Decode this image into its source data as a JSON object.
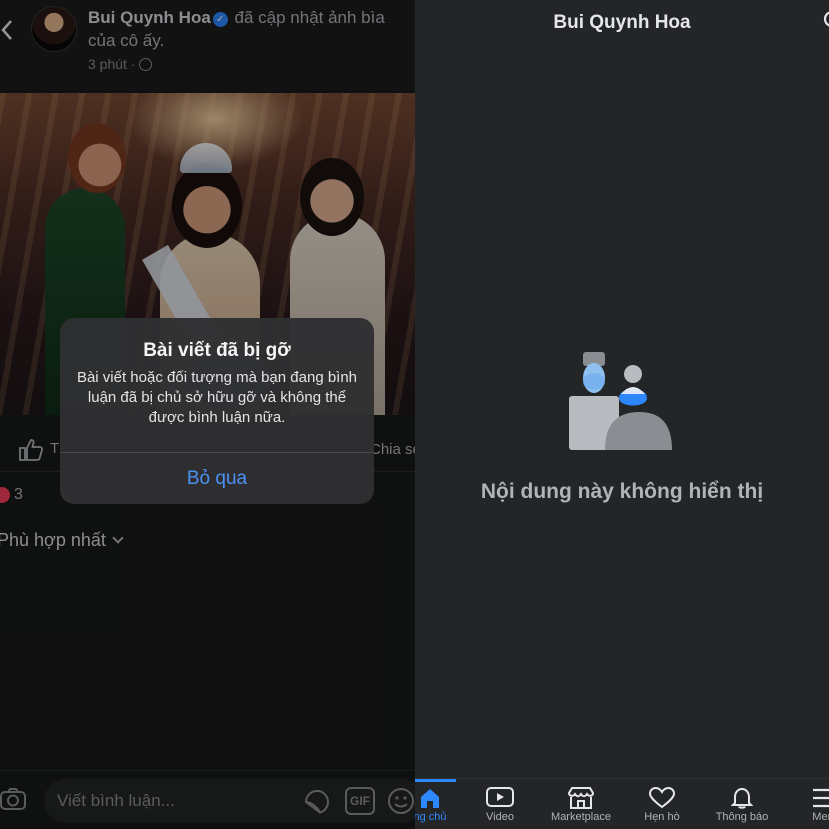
{
  "post": {
    "author_name": "Bui Quynh Hoa",
    "action_text": "đã cập nhật ảnh bìa của cô ấy.",
    "time": "3 phút ·",
    "like_label": "T",
    "share_label": "Chia sẻ",
    "reaction_count": "3",
    "sort_label": "Phù hợp nhất"
  },
  "comment_bar": {
    "placeholder": "Viết bình luận...",
    "gif_label": "GIF"
  },
  "alert": {
    "title": "Bài viết đã bị gỡ",
    "message": "Bài viết hoặc đối tượng mà bạn đang bình luận đã bị chủ sở hữu gỡ và không thể được bình luận nữa.",
    "button_label": "Bỏ qua"
  },
  "profile": {
    "title": "Bui Quynh Hoa",
    "empty_message": "Nội dung này không hiển thị"
  },
  "tabs": [
    {
      "label": "ng chủ",
      "icon": "home-icon",
      "active": true
    },
    {
      "label": "Video",
      "icon": "video-icon",
      "active": false
    },
    {
      "label": "Marketplace",
      "icon": "marketplace-icon",
      "active": false
    },
    {
      "label": "Hẹn hò",
      "icon": "heart-outline-icon",
      "active": false
    },
    {
      "label": "Thông báo",
      "icon": "bell-icon",
      "active": false
    },
    {
      "label": "Men",
      "icon": "menu-icon",
      "active": false
    }
  ],
  "colors": {
    "accent": "#2d88ff",
    "background": "#242526",
    "heart": "#f33e58"
  }
}
